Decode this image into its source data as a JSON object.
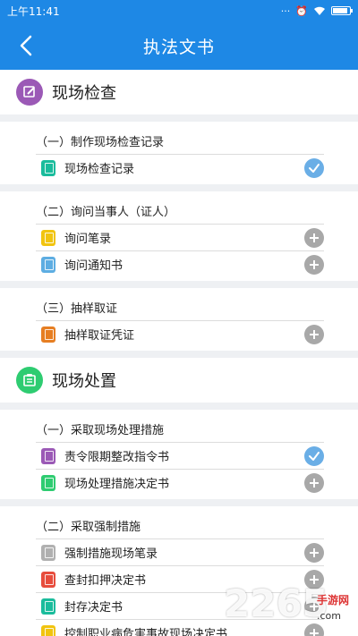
{
  "status": {
    "time": "上午11:41"
  },
  "header": {
    "title": "执法文书"
  },
  "colors": {
    "accent": "#1e88e5",
    "check": "#6aaee6",
    "add": "#a8a8a8"
  },
  "sections": [
    {
      "title": "现场检查",
      "icon": "edit-icon",
      "icon_color": "#9b59b6",
      "groups": [
        {
          "title": "（一）制作现场检查记录",
          "items": [
            {
              "label": "现场检查记录",
              "color": "#1abc9c",
              "status": "check"
            }
          ]
        },
        {
          "title": "（二）询问当事人（证人）",
          "items": [
            {
              "label": "询问笔录",
              "color": "#f1c40f",
              "status": "add"
            },
            {
              "label": "询问通知书",
              "color": "#5dade2",
              "status": "add"
            }
          ]
        },
        {
          "title": "（三）抽样取证",
          "items": [
            {
              "label": "抽样取证凭证",
              "color": "#e67e22",
              "status": "add"
            }
          ]
        }
      ]
    },
    {
      "title": "现场处置",
      "icon": "clipboard-icon",
      "icon_color": "#2ecc71",
      "groups": [
        {
          "title": "（一）采取现场处理措施",
          "items": [
            {
              "label": "责令限期整改指令书",
              "color": "#9b59b6",
              "status": "check"
            },
            {
              "label": "现场处理措施决定书",
              "color": "#2ecc71",
              "status": "add"
            }
          ]
        },
        {
          "title": "（二）采取强制措施",
          "items": [
            {
              "label": "强制措施现场笔录",
              "color": "#b0b0b0",
              "status": "add"
            },
            {
              "label": "查封扣押决定书",
              "color": "#e74c3c",
              "status": "add"
            },
            {
              "label": "封存决定书",
              "color": "#1abc9c",
              "status": "add"
            },
            {
              "label": "控制职业病危害事故现场决定书",
              "color": "#f1c40f",
              "status": "add"
            }
          ]
        }
      ]
    }
  ],
  "watermark": {
    "number": "2265",
    "site": "手游网",
    "domain": ".com"
  }
}
